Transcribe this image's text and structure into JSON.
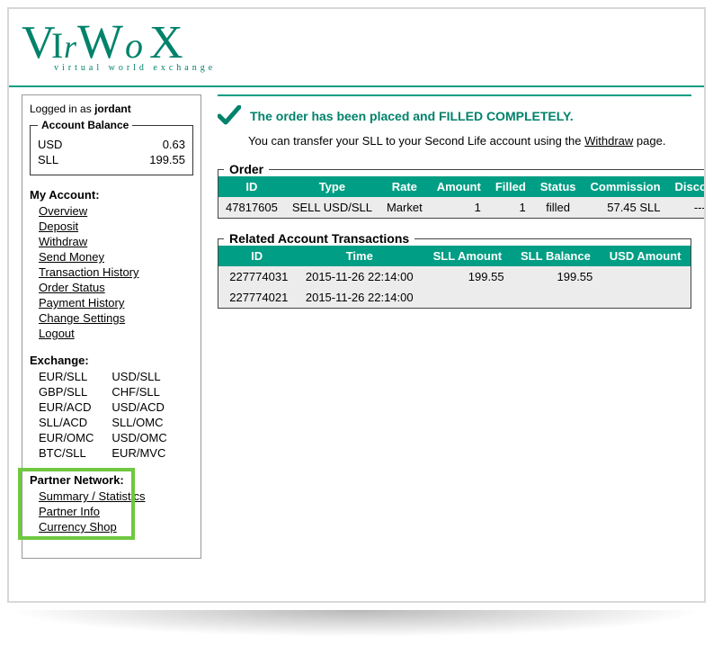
{
  "logo": {
    "main": "VirWoX",
    "tag": "virtual world exchange"
  },
  "login": {
    "prefix": "Logged in as ",
    "user": "jordant"
  },
  "balance": {
    "legend": "Account Balance",
    "rows": [
      {
        "cur": "USD",
        "val": "0.63"
      },
      {
        "cur": "SLL",
        "val": "199.55"
      }
    ]
  },
  "sidebar": {
    "my_account_h": "My Account:",
    "my_account": [
      "Overview",
      "Deposit",
      "Withdraw",
      "Send Money",
      "Transaction History",
      "Order Status",
      "Payment History",
      "Change Settings",
      "Logout"
    ],
    "exchange_h": "Exchange:",
    "exchange_col1": [
      "EUR/SLL",
      "GBP/SLL",
      "EUR/ACD",
      "SLL/ACD",
      "EUR/OMC",
      "BTC/SLL"
    ],
    "exchange_col2": [
      "USD/SLL",
      "CHF/SLL",
      "USD/ACD",
      "SLL/OMC",
      "USD/OMC",
      "EUR/MVC"
    ],
    "partner_h": "Partner Network:",
    "partner": [
      "Summary / Statistics",
      "Partner Info",
      "Currency Shop"
    ]
  },
  "confirm_msg": "The order has been placed and FILLED COMPLETELY.",
  "instr_pre": "You can transfer your SLL to your Second Life account using the ",
  "instr_link": "Withdraw",
  "instr_post": " page.",
  "order": {
    "legend": "Order",
    "headers": [
      "ID",
      "Type",
      "Rate",
      "Amount",
      "Filled",
      "Status",
      "Commission",
      "Discount"
    ],
    "rows": [
      {
        "id": "47817605",
        "type": "SELL USD/SLL",
        "rate": "Market",
        "amount": "1",
        "filled": "1",
        "status": "filled",
        "commission": "57.45 SLL",
        "discount": "---"
      }
    ]
  },
  "transactions": {
    "legend": "Related Account Transactions",
    "headers": [
      "ID",
      "Time",
      "SLL Amount",
      "SLL Balance",
      "USD Amount"
    ],
    "rows": [
      {
        "id": "227774031",
        "time": "2015-11-26 22:14:00",
        "sll_amt": "199.55",
        "sll_bal": "199.55",
        "usd_amt": ""
      },
      {
        "id": "227774021",
        "time": "2015-11-26 22:14:00",
        "sll_amt": "",
        "sll_bal": "",
        "usd_amt": ""
      }
    ]
  }
}
